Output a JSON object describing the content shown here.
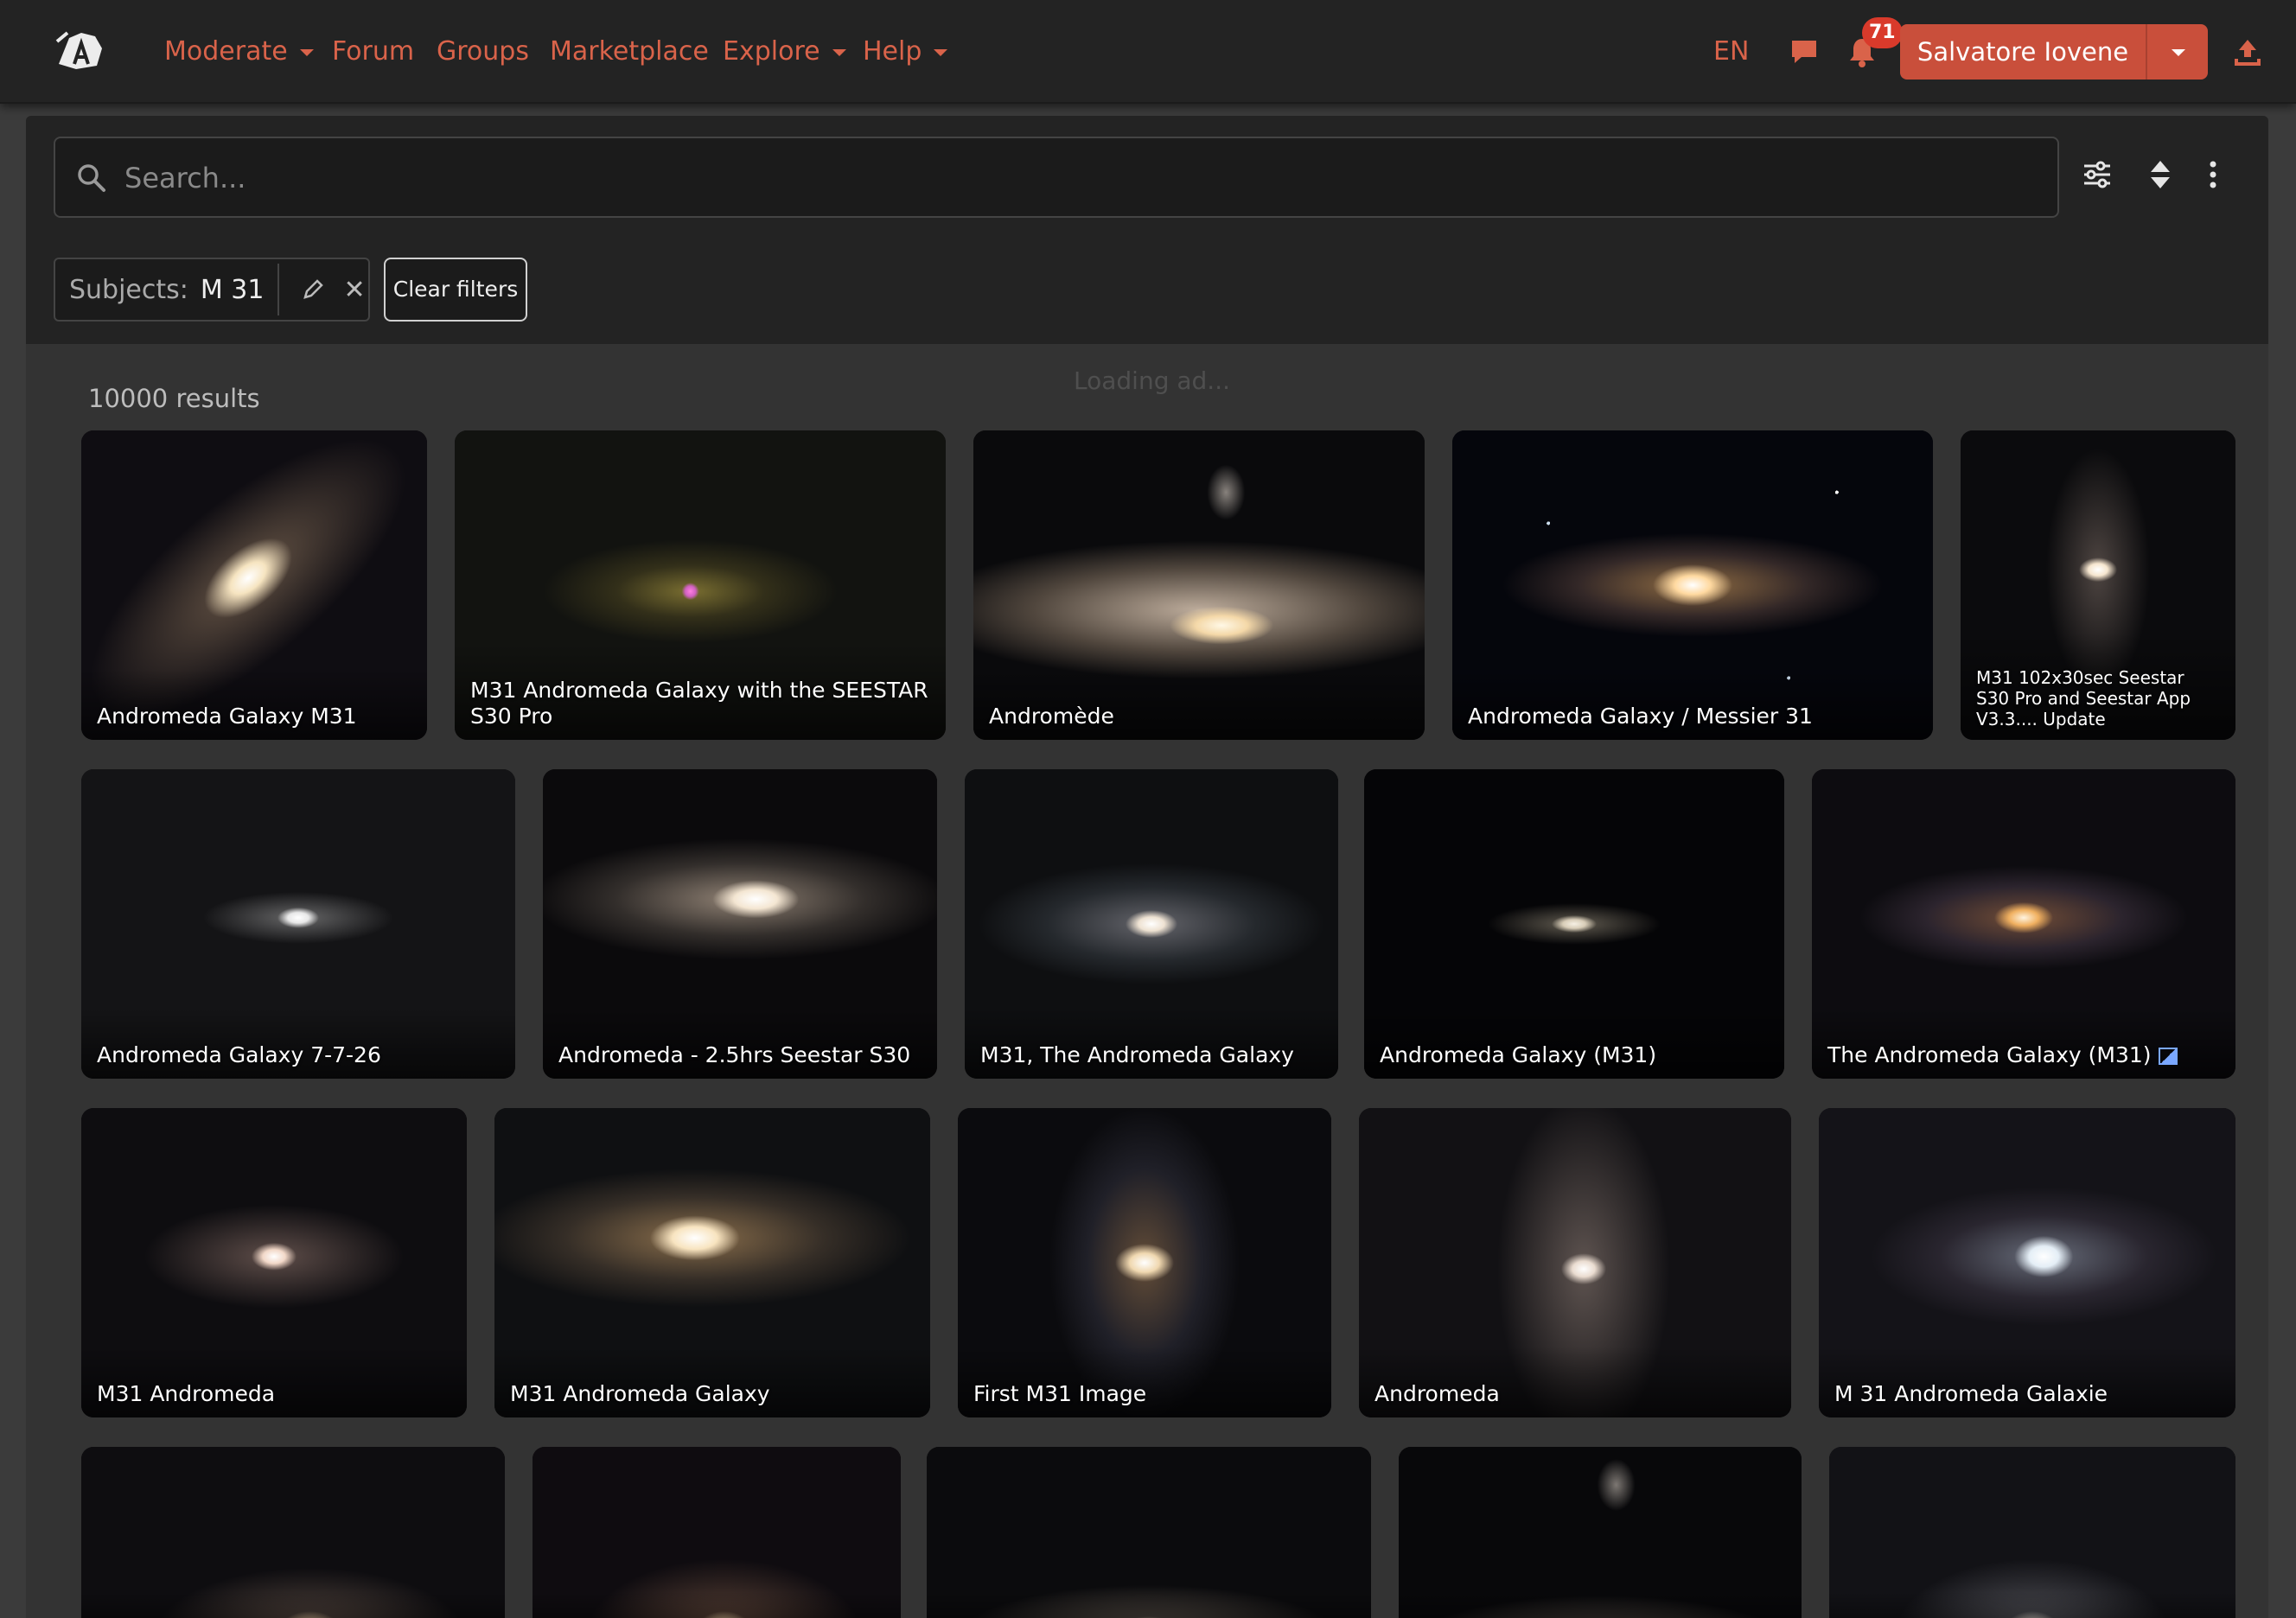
{
  "nav": {
    "items": [
      {
        "label": "Moderate",
        "dropdown": true
      },
      {
        "label": "Forum",
        "dropdown": false
      },
      {
        "label": "Groups",
        "dropdown": false
      },
      {
        "label": "Marketplace",
        "dropdown": false
      },
      {
        "label": "Explore",
        "dropdown": true
      },
      {
        "label": "Help",
        "dropdown": true
      }
    ],
    "language": "EN",
    "notification_count": "71",
    "user_name": "Salvatore Iovene",
    "accent_color": "#d9634a"
  },
  "search": {
    "placeholder": "Search...",
    "value": ""
  },
  "filters": {
    "subject_label": "Subjects:",
    "subject_value": "M 31",
    "clear_label": "Clear filters"
  },
  "results": {
    "count_label": "10000 results",
    "loading_ad": "Loading ad...",
    "images": [
      {
        "title": "Andromeda Galaxy M31"
      },
      {
        "title": "M31 Andromeda Galaxy with the SEESTAR S30 Pro"
      },
      {
        "title": "Andromède"
      },
      {
        "title": "Andromeda Galaxy / Messier 31"
      },
      {
        "title": "M31 102x30sec Seestar S30 Pro and Seestar App V3.3.... Update"
      },
      {
        "title": "Andromeda Galaxy 7-7-26"
      },
      {
        "title": "Andromeda - 2.5hrs Seestar S30"
      },
      {
        "title": "M31, The Andromeda Galaxy"
      },
      {
        "title": "Andromeda Galaxy (M31)"
      },
      {
        "title": "The Andromeda Galaxy (M31)"
      },
      {
        "title": "M31 Andromeda"
      },
      {
        "title": "M31 Andromeda Galaxy"
      },
      {
        "title": "First M31 Image"
      },
      {
        "title": "Andromeda"
      },
      {
        "title": "M 31 Andromeda Galaxie"
      },
      {
        "title": ""
      },
      {
        "title": ""
      },
      {
        "title": ""
      },
      {
        "title": ""
      },
      {
        "title": ""
      }
    ]
  }
}
